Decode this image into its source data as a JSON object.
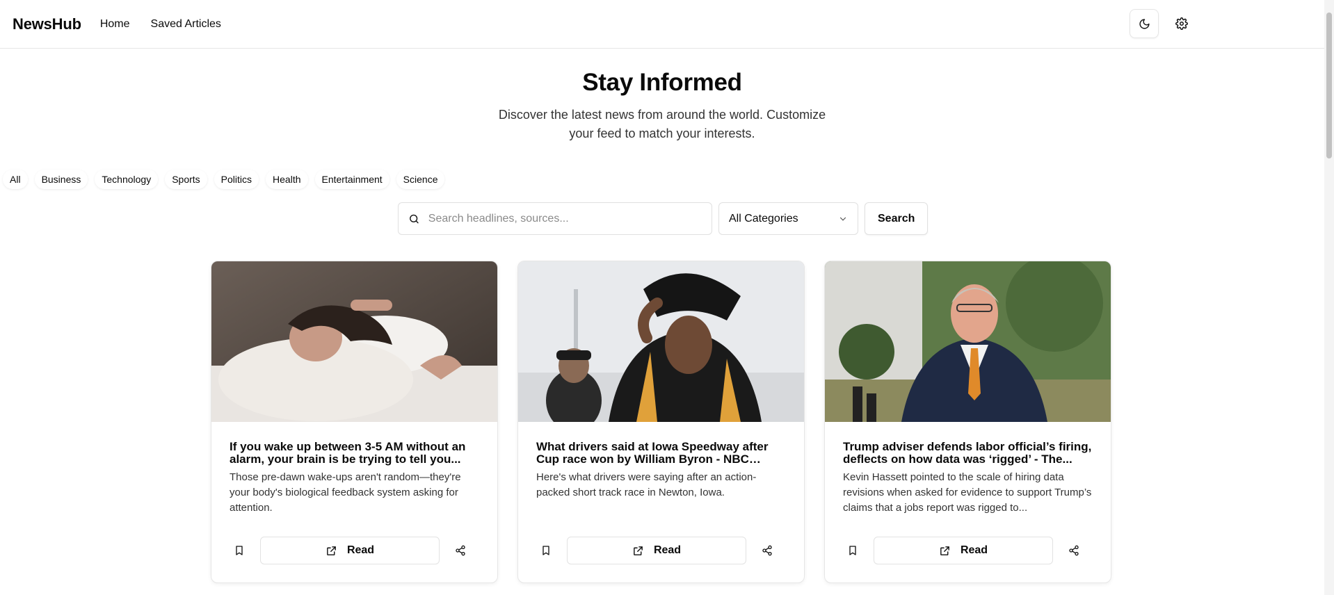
{
  "header": {
    "brand": "NewsHub",
    "nav": [
      "Home",
      "Saved Articles"
    ],
    "icons": [
      "moon-icon",
      "gear-icon"
    ]
  },
  "hero": {
    "title": "Stay Informed",
    "subtitle": "Discover the latest news from around the world. Customize your feed to match your interests."
  },
  "categories": [
    "All",
    "Business",
    "Technology",
    "Sports",
    "Politics",
    "Health",
    "Entertainment",
    "Science"
  ],
  "search": {
    "placeholder": "Search headlines, sources...",
    "category_value": "All Categories",
    "button_label": "Search"
  },
  "articles": [
    {
      "title": "If you wake up between 3-5 AM without an alarm, your brain is be trying to tell you...",
      "description": "Those pre-dawn wake-ups aren't random—they're your body's biological feedback system asking for attention.",
      "read_label": "Read",
      "image_alt": "Woman lying awake in bed"
    },
    {
      "title": "What drivers said at Iowa Speedway after Cup race won by William Byron - NBC Sports",
      "description": "Here's what drivers were saying after an action-packed short track race in Newton, Iowa.",
      "read_label": "Read",
      "image_alt": "Race driver adjusting helmet"
    },
    {
      "title": "Trump adviser defends labor official’s firing, deflects on how data was ‘rigged’ - The...",
      "description": "Kevin Hassett pointed to the scale of hiring data revisions when asked for evidence to support Trump’s claims that a jobs report was rigged to...",
      "read_label": "Read",
      "image_alt": "Man in suit speaking outdoors"
    }
  ],
  "colors": {
    "text": "#0a0a0a",
    "border": "#e6e6e6",
    "muted": "#8a8a8a"
  }
}
